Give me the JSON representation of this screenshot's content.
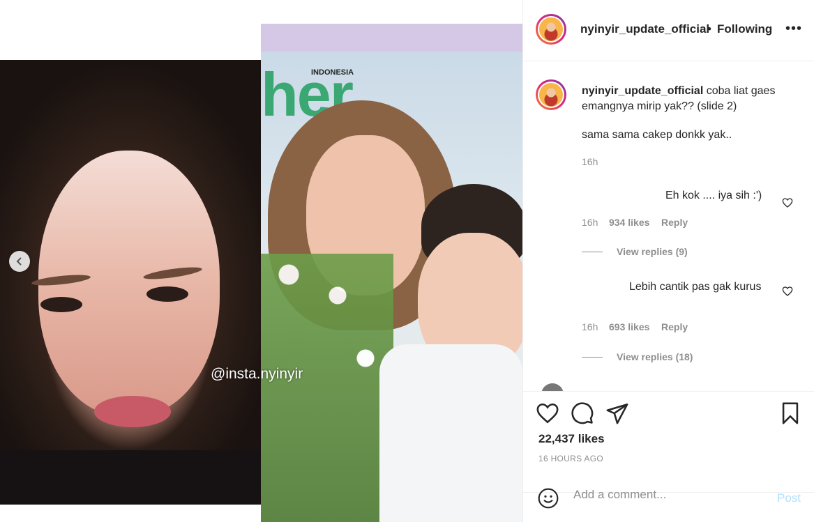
{
  "media": {
    "watermark": "@insta.nyinyir",
    "cover_label": "INDONESIA",
    "cover_masthead": "her"
  },
  "header": {
    "username": "nyinyir_update_official",
    "separator": "•",
    "follow_status": "Following",
    "more": "•••"
  },
  "caption": {
    "username": "nyinyir_update_official",
    "text": "coba liat gaes emangnya mirip yak?? (slide 2)",
    "text2": "sama sama cakep donkk yak..",
    "time": "16h"
  },
  "comments": [
    {
      "text": "Eh kok .... iya sih :')",
      "time": "16h",
      "likes": "934 likes",
      "reply": "Reply",
      "view_replies": "View replies (9)"
    },
    {
      "text": "Lebih cantik pas gak kurus",
      "time": "16h",
      "likes": "693 likes",
      "reply": "Reply",
      "view_replies": "View replies (18)"
    }
  ],
  "actions": {
    "likes": "22,437 likes",
    "time": "16 HOURS AGO"
  },
  "add_comment": {
    "placeholder": "Add a comment...",
    "post": "Post"
  }
}
